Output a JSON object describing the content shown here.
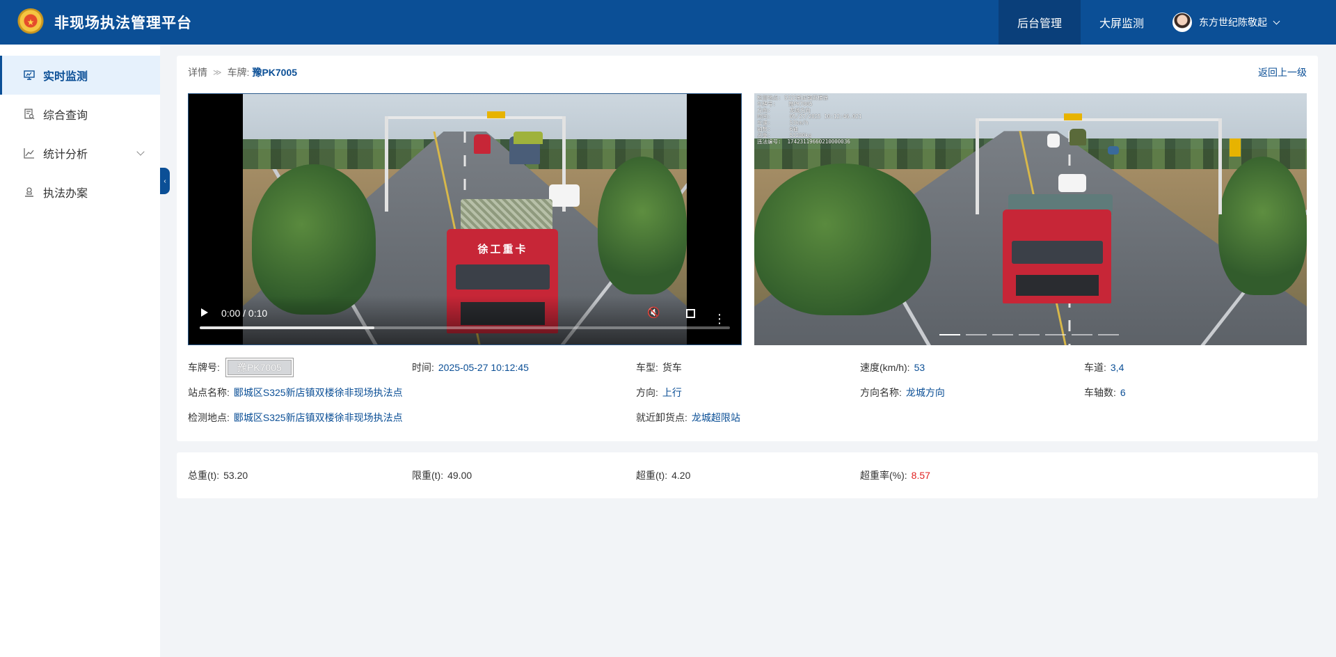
{
  "header": {
    "title": "非现场执法管理平台",
    "nav": [
      "后台管理",
      "大屏监测"
    ],
    "user_name": "东方世纪陈敬起"
  },
  "sidebar": {
    "items": [
      {
        "label": "实时监测",
        "icon": "monitor-icon",
        "active": true
      },
      {
        "label": "综合查询",
        "icon": "document-search-icon"
      },
      {
        "label": "统计分析",
        "icon": "line-chart-icon",
        "expandable": true
      },
      {
        "label": "执法办案",
        "icon": "user-stamp-icon"
      }
    ]
  },
  "breadcrumb": {
    "detail": "详情",
    "plate_prefix": "车牌:",
    "plate": "豫PK7005"
  },
  "back_label": "返回上一级",
  "video": {
    "time": "0:00 / 0:10",
    "progress": 0.33,
    "truck_text": "徐工重卡"
  },
  "photo": {
    "overlay": "检测地点: S325新店镇双楼徐\n车牌号:    豫PK7005\n方向:      龙城方向\n时间:      05/27/2025 10:12:46.021\n车速:      53km/h\n轴数:      6轴\n总重:      53200kg\n违法编号:  17423119660210000036",
    "slides": 7,
    "active_slide": 0
  },
  "info": {
    "plate_label": "车牌号:",
    "plate_value": "豫PK7005",
    "time_label": "时间:",
    "time_value": "2025-05-27 10:12:45",
    "type_label": "车型:",
    "type_value": "货车",
    "speed_label": "速度(km/h):",
    "speed_value": "53",
    "lane_label": "车道:",
    "lane_value": "3,4",
    "station_label": "站点名称:",
    "station_value": "郾城区S325新店镇双楼徐非现场执法点",
    "dir_label": "方向:",
    "dir_value": "上行",
    "dirname_label": "方向名称:",
    "dirname_value": "龙城方向",
    "axle_label": "车轴数:",
    "axle_value": "6",
    "site_label": "检测地点:",
    "site_value": "郾城区S325新店镇双楼徐非现场执法点",
    "unload_label": "就近卸货点:",
    "unload_value": "龙城超限站"
  },
  "weight": {
    "total_label": "总重(t):",
    "total_value": "53.20",
    "limit_label": "限重(t):",
    "limit_value": "49.00",
    "over_label": "超重(t):",
    "over_value": "4.20",
    "rate_label": "超重率(%):",
    "rate_value": "8.57"
  },
  "colors": {
    "primary": "#0b4f96",
    "danger": "#e02020"
  }
}
